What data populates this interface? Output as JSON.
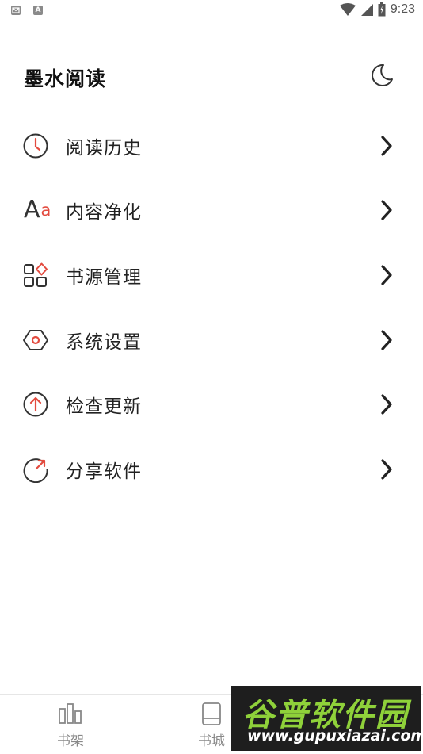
{
  "status_bar": {
    "left_icons": [
      "mail-notification-icon",
      "text-notification-icon"
    ],
    "notification_letter": "A",
    "right_icons": [
      "wifi-icon",
      "signal-icon",
      "battery-icon"
    ],
    "time": "9:23"
  },
  "header": {
    "title": "墨水阅读",
    "night_mode_icon": "moon-icon"
  },
  "menu": {
    "items": [
      {
        "label": "阅读历史",
        "icon": "clock-icon"
      },
      {
        "label": "内容净化",
        "icon": "font-aa-icon",
        "icon_text_a": "A",
        "icon_text_b": "a"
      },
      {
        "label": "书源管理",
        "icon": "grid-diamond-icon"
      },
      {
        "label": "系统设置",
        "icon": "hexagon-settings-icon"
      },
      {
        "label": "检查更新",
        "icon": "arrow-up-circle-icon"
      },
      {
        "label": "分享软件",
        "icon": "share-refresh-icon"
      }
    ],
    "arrow_icon": "chevron-right-icon"
  },
  "tabbar": {
    "tabs": [
      {
        "label": "书架",
        "icon": "bookshelf-icon"
      },
      {
        "label": "书城",
        "icon": "book-icon"
      }
    ]
  },
  "watermark": {
    "main": "谷普软件园",
    "sub": "www.gupuxiazai.com"
  },
  "colors": {
    "accent": "#e34b3f",
    "icon": "#333333",
    "text": "#222222",
    "tab_text": "#888888"
  }
}
